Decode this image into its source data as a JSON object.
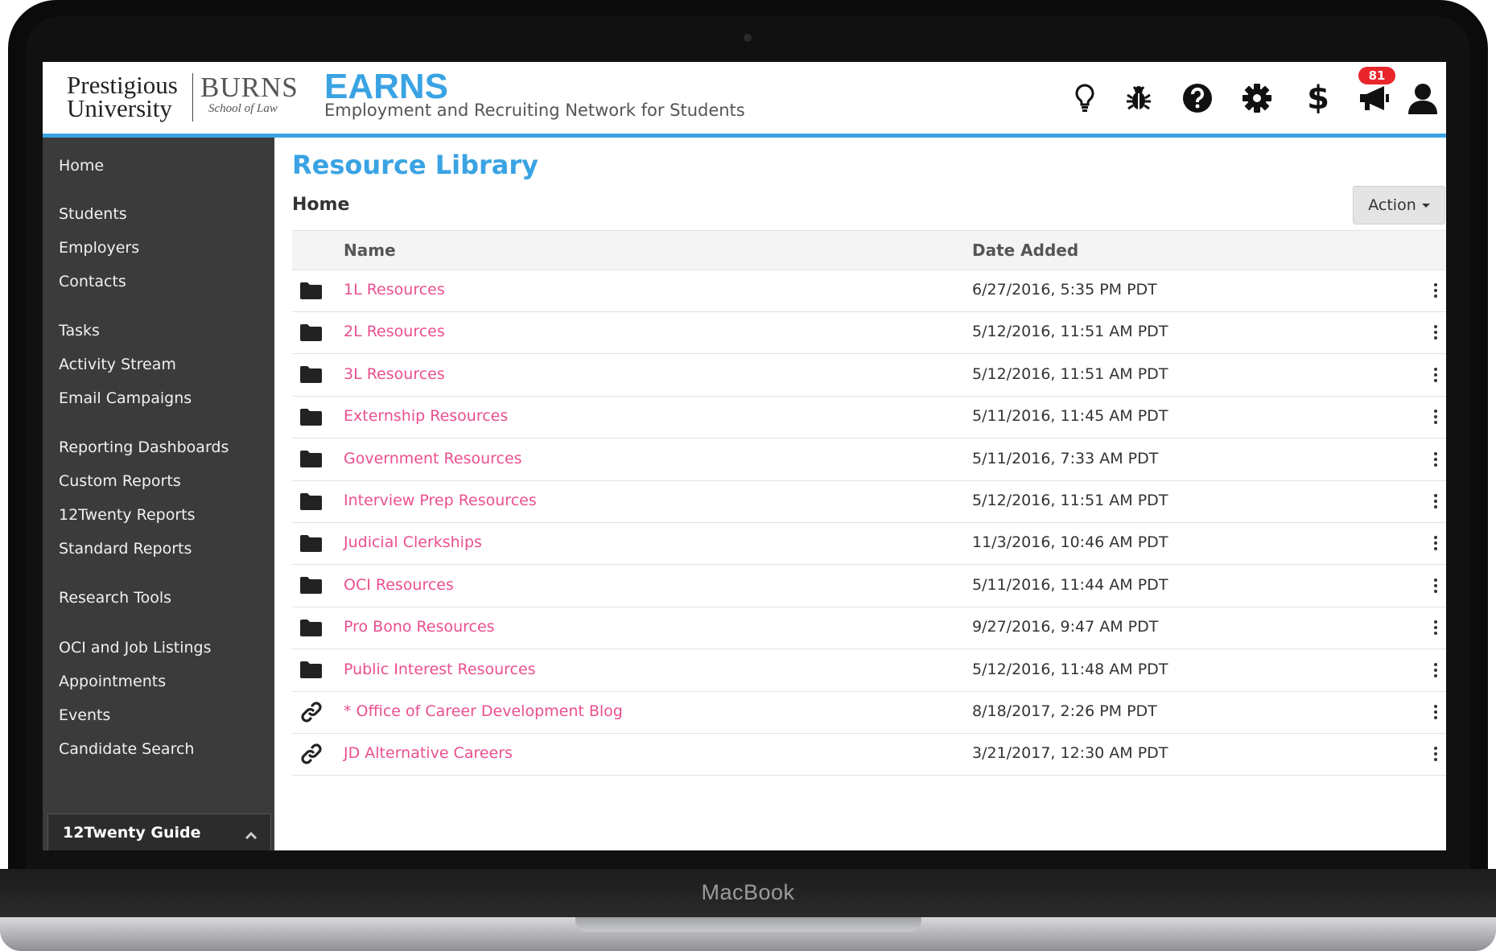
{
  "device": {
    "label": "MacBook"
  },
  "header": {
    "logo_line1": "Prestigious",
    "logo_line2": "University",
    "logo_burns": "BURNS",
    "logo_school": "School of Law",
    "brand": "EARNS",
    "tagline": "Employment and Recruiting Network for Students",
    "icons": [
      "lightbulb-icon",
      "bug-icon",
      "help-icon",
      "gear-icon",
      "dollar-icon",
      "megaphone-icon",
      "user-icon"
    ],
    "notification_count": "81",
    "accent_color": "#3aa3e3"
  },
  "sidebar": {
    "items": [
      {
        "label": "Home"
      },
      {
        "label": "Students"
      },
      {
        "label": "Employers"
      },
      {
        "label": "Contacts"
      },
      {
        "label": "Tasks"
      },
      {
        "label": "Activity Stream"
      },
      {
        "label": "Email Campaigns"
      },
      {
        "label": "Reporting Dashboards"
      },
      {
        "label": "Custom Reports"
      },
      {
        "label": "12Twenty Reports"
      },
      {
        "label": "Standard Reports"
      },
      {
        "label": "Research Tools"
      },
      {
        "label": "OCI and Job Listings"
      },
      {
        "label": "Appointments"
      },
      {
        "label": "Events"
      },
      {
        "label": "Candidate Search"
      }
    ],
    "guide": {
      "label": "12Twenty Guide",
      "icon": "chevron-up-icon"
    }
  },
  "main": {
    "title": "Resource Library",
    "breadcrumb": "Home",
    "action_label": "Action",
    "link_color": "#ea4f8f",
    "table": {
      "columns": [
        "Name",
        "Date Added"
      ],
      "rows": [
        {
          "icon": "folder-icon",
          "name": "1L Resources",
          "date": "6/27/2016, 5:35 PM PDT"
        },
        {
          "icon": "folder-icon",
          "name": "2L Resources",
          "date": "5/12/2016, 11:51 AM PDT"
        },
        {
          "icon": "folder-icon",
          "name": "3L Resources",
          "date": "5/12/2016, 11:51 AM PDT"
        },
        {
          "icon": "folder-icon",
          "name": "Externship Resources",
          "date": "5/11/2016, 11:45 AM PDT"
        },
        {
          "icon": "folder-icon",
          "name": "Government Resources",
          "date": "5/11/2016, 7:33 AM PDT"
        },
        {
          "icon": "folder-icon",
          "name": "Interview Prep Resources",
          "date": "5/12/2016, 11:51 AM PDT"
        },
        {
          "icon": "folder-icon",
          "name": "Judicial Clerkships",
          "date": "11/3/2016, 10:46 AM PDT"
        },
        {
          "icon": "folder-icon",
          "name": "OCI Resources",
          "date": "5/11/2016, 11:44 AM PDT"
        },
        {
          "icon": "folder-icon",
          "name": "Pro Bono Resources",
          "date": "9/27/2016, 9:47 AM PDT"
        },
        {
          "icon": "folder-icon",
          "name": "Public Interest Resources",
          "date": "5/12/2016, 11:48 AM PDT"
        },
        {
          "icon": "link-icon",
          "name": "* Office of Career Development Blog",
          "date": "8/18/2017, 2:26 PM PDT"
        },
        {
          "icon": "link-icon",
          "name": "JD Alternative Careers",
          "date": "3/21/2017, 12:30 AM PDT"
        }
      ]
    }
  }
}
